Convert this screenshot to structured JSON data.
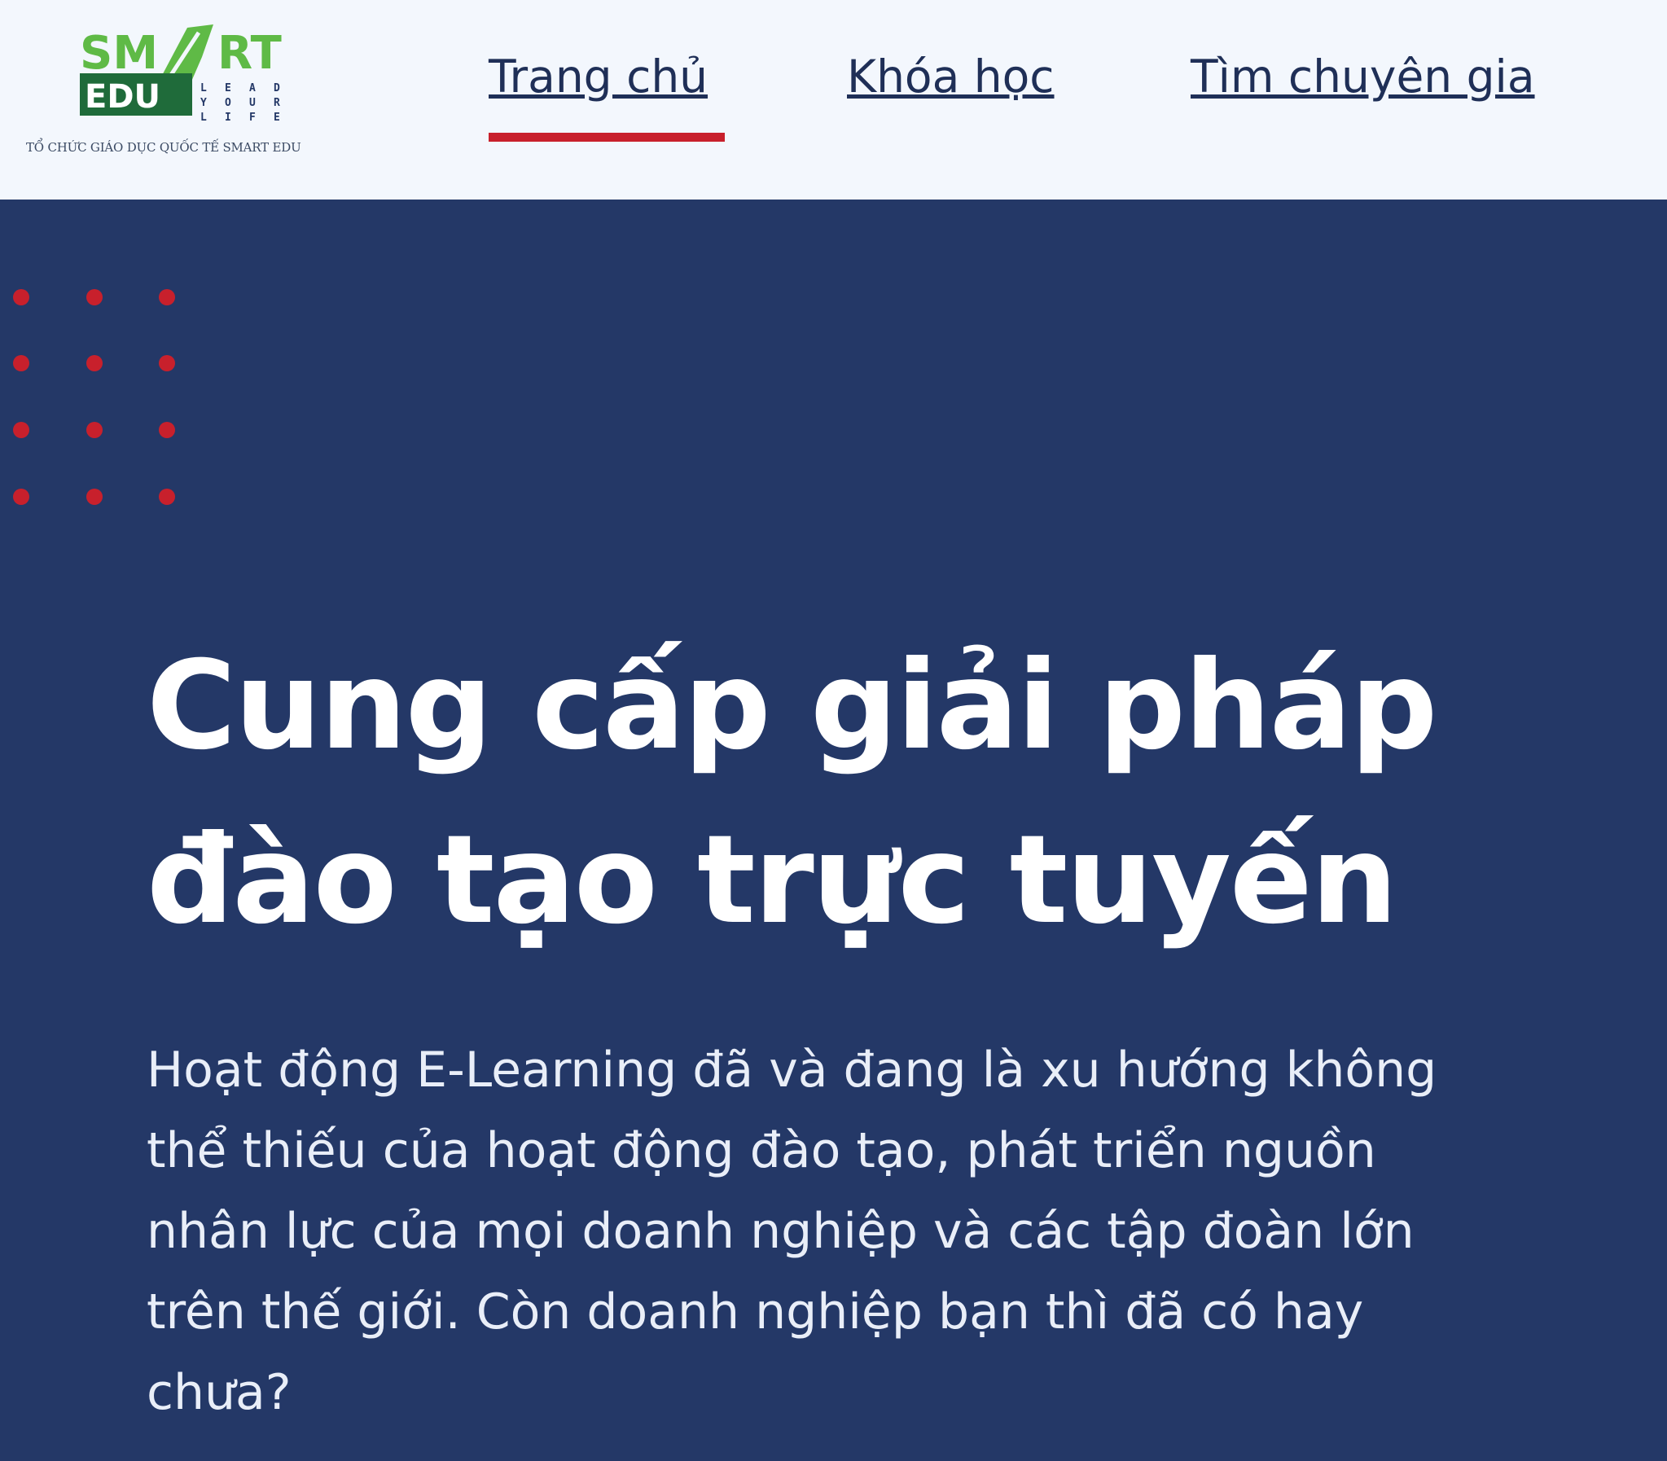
{
  "header": {
    "logo": {
      "brand_text": "SMART EDU",
      "tagline": "LEAD YOUR LIFE",
      "caption": "TỔ CHỨC GIÁO DỤC QUỐC TẾ SMART EDU"
    },
    "nav": [
      {
        "label": "Trang chủ",
        "active": true
      },
      {
        "label": "Khóa học",
        "active": false
      },
      {
        "label": "Tìm chuyên gia",
        "active": false
      }
    ],
    "active_indicator_color": "#c8202c"
  },
  "hero": {
    "title_line1": "Cung cấp giải pháp",
    "title_line2": "đào tạo trực tuyến",
    "description": "Hoạt động E-Learning đã và đang là xu hướng không thể thiếu của hoạt động đào tạo, phát triển nguồn nhân lực của mọi doanh nghiệp và các tập đoàn lớn trên thế giới. Còn doanh nghiệp bạn thì đã có hay chưa?"
  },
  "colors": {
    "header_bg": "#f3f7fd",
    "hero_bg": "#243867",
    "nav_text": "#1f2f57",
    "accent_red": "#c8202c",
    "logo_green": "#5fba46",
    "logo_dark_green": "#1f6b3a"
  }
}
